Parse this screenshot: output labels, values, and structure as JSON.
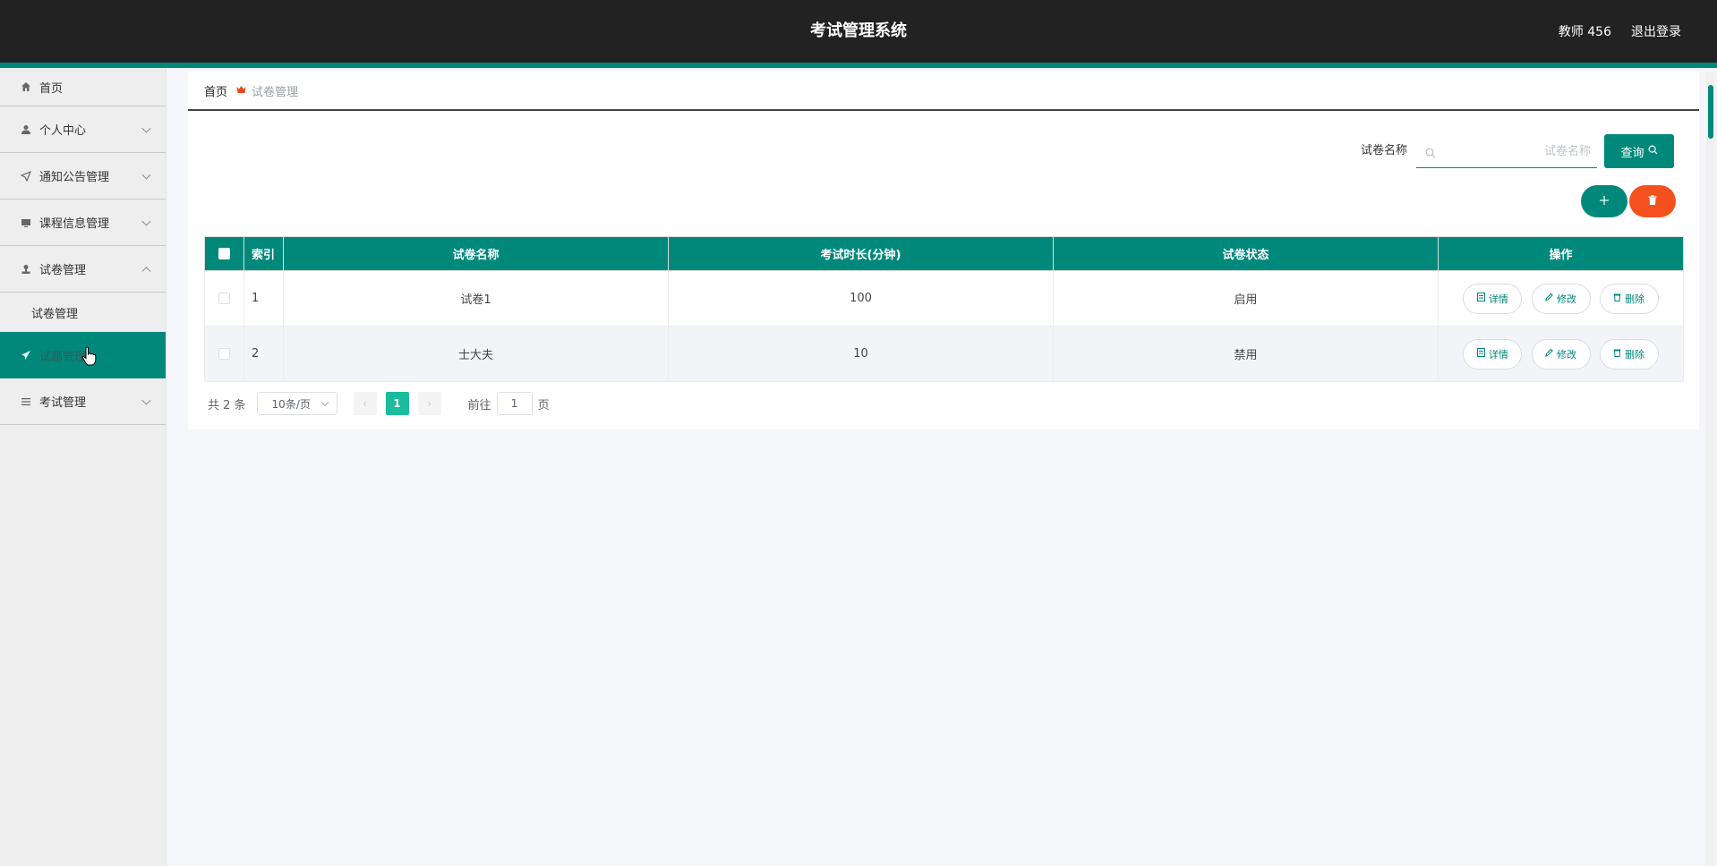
{
  "header": {
    "title": "考试管理系统",
    "user": "教师 456",
    "logout_label": "退出登录"
  },
  "sidebar": {
    "items": [
      {
        "label": "首页",
        "icon": "home-icon"
      },
      {
        "label": "个人中心",
        "icon": "user-icon"
      },
      {
        "label": "通知公告管理",
        "icon": "send-icon"
      },
      {
        "label": "课程信息管理",
        "icon": "monitor-icon"
      },
      {
        "label": "试卷管理",
        "icon": "stamp-icon",
        "expanded": true,
        "children": [
          {
            "label": "试卷管理"
          }
        ]
      },
      {
        "label": "试题管理",
        "icon": "paper-plane-icon",
        "active": true
      },
      {
        "label": "考试管理",
        "icon": "list-icon"
      }
    ]
  },
  "breadcrumb": {
    "home": "首页",
    "current": "试卷管理"
  },
  "search": {
    "label": "试卷名称",
    "placeholder": "试卷名称",
    "value": "",
    "button_label": "查询"
  },
  "actions": {
    "add_icon": "plus-icon",
    "delete_icon": "trash-icon"
  },
  "table": {
    "columns": [
      "索引",
      "试卷名称",
      "考试时长(分钟)",
      "试卷状态",
      "操作"
    ],
    "rows": [
      {
        "index": "1",
        "name": "试卷1",
        "duration": "100",
        "status": "启用"
      },
      {
        "index": "2",
        "name": "士大夫",
        "duration": "10",
        "status": "禁用"
      }
    ],
    "row_actions": {
      "detail": "详情",
      "edit": "修改",
      "delete": "删除"
    }
  },
  "pagination": {
    "total": "共 2 条",
    "page_size": "10条/页",
    "current_page": "1",
    "goto_prefix": "前往",
    "goto_value": "1",
    "goto_suffix": "页"
  },
  "colors": {
    "header_bg": "#222222",
    "accent": "#00897b",
    "danger": "#f4511e",
    "page_active": "#1abc9c"
  }
}
